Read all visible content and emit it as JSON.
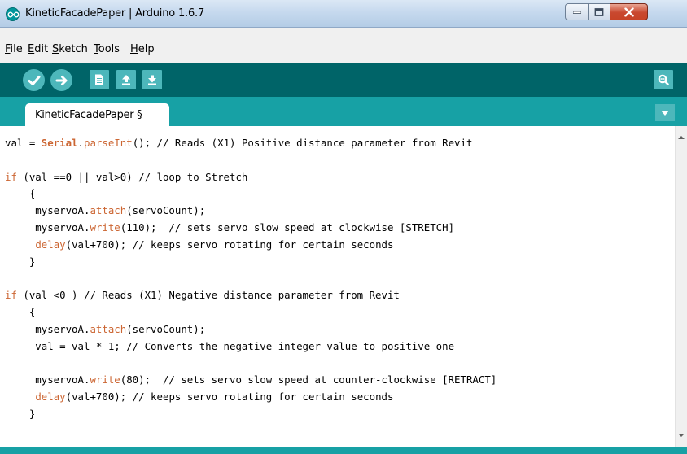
{
  "window": {
    "title": "KineticFacadePaper | Arduino 1.6.7"
  },
  "menu": [
    {
      "mnemonic": "F",
      "rest": "ile"
    },
    {
      "mnemonic": "E",
      "rest": "dit"
    },
    {
      "mnemonic": "S",
      "rest": "ketch"
    },
    {
      "mnemonic": "T",
      "rest": "ools"
    },
    {
      "mnemonic": "H",
      "rest": "elp"
    }
  ],
  "toolbar": {
    "icons": [
      "verify-icon",
      "upload-icon",
      "new-icon",
      "open-icon",
      "save-icon",
      "serial-monitor-icon"
    ]
  },
  "tab": {
    "label": "KineticFacadePaper §"
  },
  "colors": {
    "toolbar": "#006468",
    "tabstrip": "#17a1a5",
    "button": "#4db7bb",
    "keyword": "#cc6633"
  },
  "code": [
    [
      {
        "t": "val = "
      },
      {
        "t": "Serial",
        "c": "cls"
      },
      {
        "t": "."
      },
      {
        "t": "parseInt",
        "c": "fn"
      },
      {
        "t": "(); // Reads (X1) Positive distance parameter from Revit"
      }
    ],
    [],
    [
      {
        "t": "if",
        "c": "kw"
      },
      {
        "t": " (val ==0 || val>0) // loop to Stretch"
      }
    ],
    [
      {
        "t": "    {"
      }
    ],
    [
      {
        "t": "     myservoA."
      },
      {
        "t": "attach",
        "c": "fn"
      },
      {
        "t": "(servoCount);"
      }
    ],
    [
      {
        "t": "     myservoA."
      },
      {
        "t": "write",
        "c": "fn"
      },
      {
        "t": "(110);  // sets servo slow speed at clockwise [STRETCH]"
      }
    ],
    [
      {
        "t": "     "
      },
      {
        "t": "delay",
        "c": "fn"
      },
      {
        "t": "(val+700); // keeps servo rotating for certain seconds"
      }
    ],
    [
      {
        "t": "    }"
      }
    ],
    [],
    [
      {
        "t": "if",
        "c": "kw"
      },
      {
        "t": " (val <0 ) // Reads (X1) Negative distance parameter from Revit"
      }
    ],
    [
      {
        "t": "    {"
      }
    ],
    [
      {
        "t": "     myservoA."
      },
      {
        "t": "attach",
        "c": "fn"
      },
      {
        "t": "(servoCount);"
      }
    ],
    [
      {
        "t": "     val = val *-1; // Converts the negative integer value to positive one"
      }
    ],
    [],
    [
      {
        "t": "     myservoA."
      },
      {
        "t": "write",
        "c": "fn"
      },
      {
        "t": "(80);  // sets servo slow speed at counter-clockwise [RETRACT]"
      }
    ],
    [
      {
        "t": "     "
      },
      {
        "t": "delay",
        "c": "fn"
      },
      {
        "t": "(val+700); // keeps servo rotating for certain seconds"
      }
    ],
    [
      {
        "t": "    }"
      }
    ]
  ]
}
